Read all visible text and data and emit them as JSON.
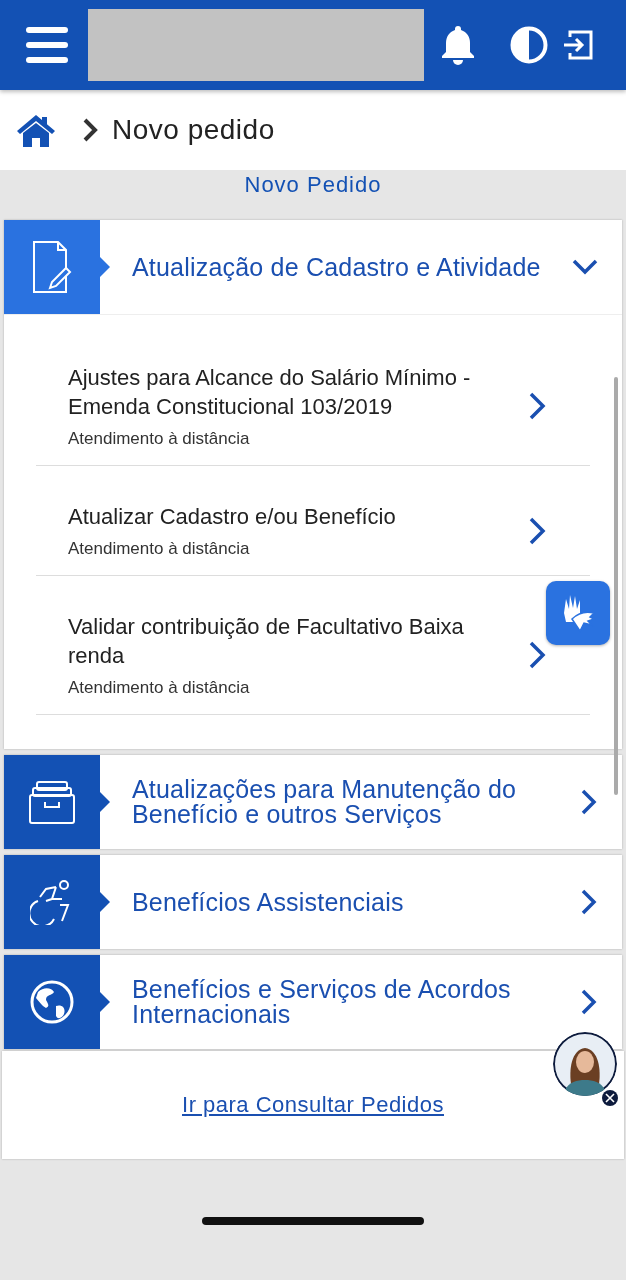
{
  "breadcrumb": {
    "current": "Novo pedido"
  },
  "page_title": "Novo Pedido",
  "categories": [
    {
      "title": "Atualização de Cadastro e Atividade",
      "expanded": true,
      "services": [
        {
          "title": "Ajustes para Alcance do Salário Mínimo - Emenda Constitucional 103/2019",
          "mode": "Atendimento à distância"
        },
        {
          "title": "Atualizar Cadastro e/ou Benefício",
          "mode": "Atendimento à distância"
        },
        {
          "title": "Validar contribuição de Facultativo Baixa renda",
          "mode": "Atendimento à distância"
        }
      ]
    },
    {
      "title": "Atualizações para Manutenção do Benefício e outros Serviços",
      "expanded": false
    },
    {
      "title": "Benefícios Assistenciais",
      "expanded": false
    },
    {
      "title": "Benefícios e Serviços de Acordos Internacionais",
      "expanded": false
    }
  ],
  "footer_link": "Ir para Consultar Pedidos"
}
